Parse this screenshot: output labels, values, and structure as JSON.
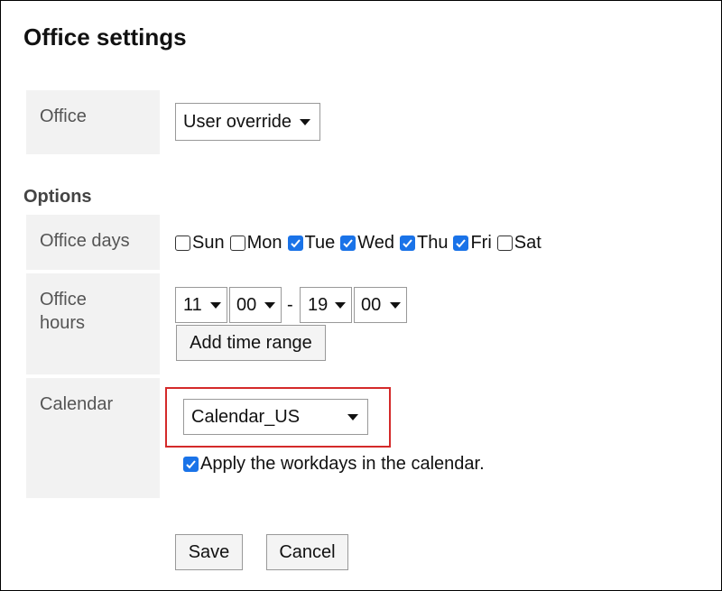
{
  "page": {
    "title": "Office settings"
  },
  "office": {
    "label": "Office",
    "selected": "User override"
  },
  "options": {
    "heading": "Options",
    "office_days": {
      "label": "Office days",
      "days": [
        {
          "name": "Sun",
          "checked": false
        },
        {
          "name": "Mon",
          "checked": false
        },
        {
          "name": "Tue",
          "checked": true
        },
        {
          "name": "Wed",
          "checked": true
        },
        {
          "name": "Thu",
          "checked": true
        },
        {
          "name": "Fri",
          "checked": true
        },
        {
          "name": "Sat",
          "checked": false
        }
      ]
    },
    "office_hours": {
      "label_line1": "Office",
      "label_line2": "hours",
      "start_hour": "11",
      "start_minute": "00",
      "separator": "-",
      "end_hour": "19",
      "end_minute": "00",
      "add_time_range_label": "Add time range"
    },
    "calendar": {
      "label": "Calendar",
      "selected": "Calendar_US",
      "apply_label": "Apply the workdays in the calendar.",
      "apply_checked": true
    }
  },
  "actions": {
    "save_label": "Save",
    "cancel_label": "Cancel"
  },
  "colors": {
    "checkbox_checked": "#1a73e8",
    "highlight_border": "#d42a2a",
    "label_cell_bg": "#f2f2f2"
  }
}
